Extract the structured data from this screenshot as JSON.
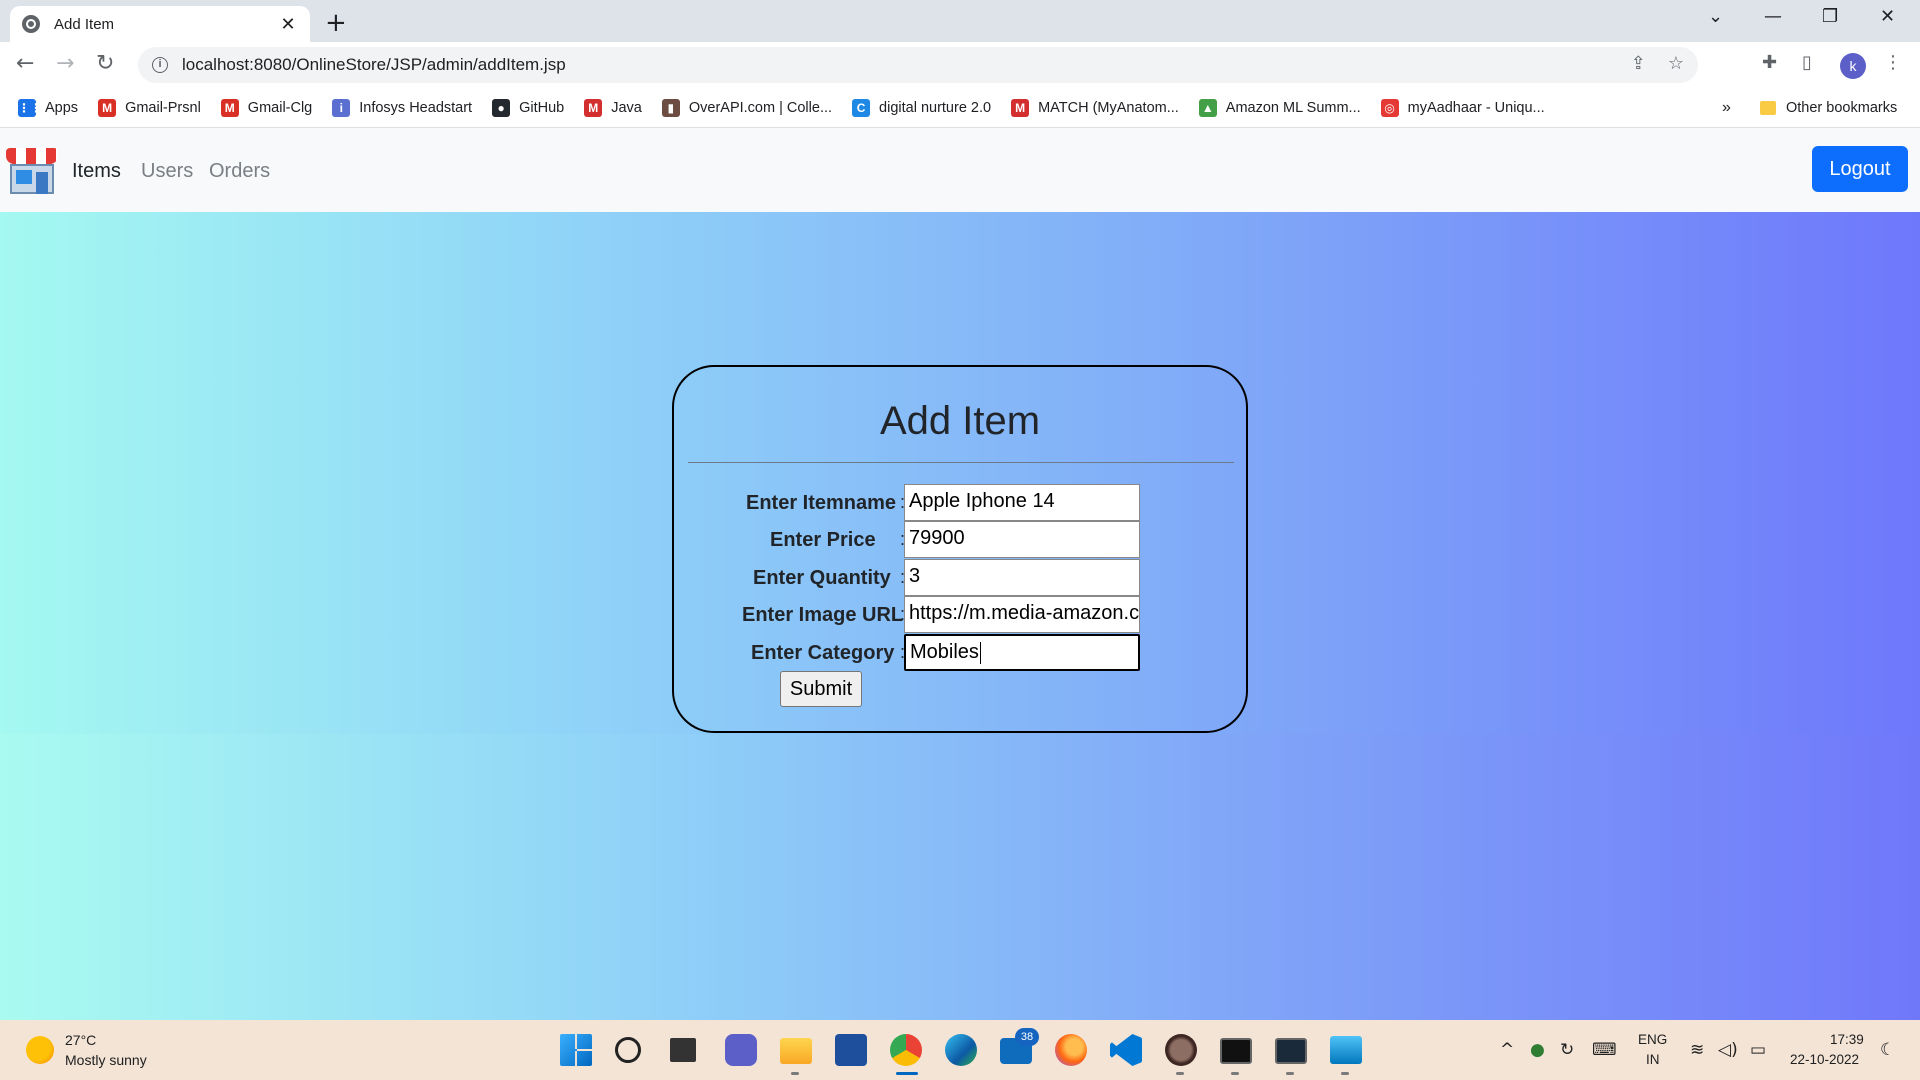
{
  "browser": {
    "tab_title": "Add Item",
    "tab_close": "✕",
    "new_tab": "+",
    "url": "localhost:8080/OnlineStore/JSP/admin/addItem.jsp",
    "profile_initial": "k",
    "window_controls": {
      "chevron": "⌄",
      "minimize": "—",
      "restore": "❐",
      "close": "✕"
    },
    "bookmarks": [
      {
        "label": "Apps",
        "icon": "apps-grid-icon",
        "color": "#1a73e8"
      },
      {
        "label": "Gmail-Prsnl",
        "icon": "gmail-icon",
        "color": "#d93025"
      },
      {
        "label": "Gmail-Clg",
        "icon": "gmail-icon",
        "color": "#d93025"
      },
      {
        "label": "Infosys Headstart",
        "icon": "infosys-icon",
        "color": "#5b6fd1"
      },
      {
        "label": "GitHub",
        "icon": "github-icon",
        "color": "#24292f"
      },
      {
        "label": "Java",
        "icon": "java-icon",
        "color": "#d32f2f"
      },
      {
        "label": "OverAPI.com | Colle...",
        "icon": "overapi-icon",
        "color": "#6d4c41"
      },
      {
        "label": "digital nurture 2.0",
        "icon": "digital-nurture-icon",
        "color": "#1e88e5"
      },
      {
        "label": "MATCH (MyAnatom...",
        "icon": "match-icon",
        "color": "#d32f2f"
      },
      {
        "label": "Amazon ML Summ...",
        "icon": "amazon-ml-icon",
        "color": "#43a047"
      },
      {
        "label": "myAadhaar - Uniqu...",
        "icon": "aadhaar-icon",
        "color": "#e53935"
      }
    ],
    "more_bookmarks": "»",
    "other_bookmarks": "Other bookmarks"
  },
  "site_nav": {
    "links": [
      {
        "label": "Items",
        "active": true
      },
      {
        "label": "Users",
        "active": false
      },
      {
        "label": "Orders",
        "active": false
      }
    ],
    "logout_label": "Logout",
    "accent": "#0d6efd"
  },
  "form": {
    "title": "Add Item",
    "fields": [
      {
        "label": "Enter Itemname",
        "colon": ":",
        "value": "Apple Iphone 14"
      },
      {
        "label": "Enter Price",
        "colon": ":",
        "value": "79900"
      },
      {
        "label": "Enter Quantity",
        "colon": ":",
        "value": "3"
      },
      {
        "label": "Enter Image URL",
        "colon": ":",
        "value": "https://m.media-amazon.com"
      },
      {
        "label": "Enter Category",
        "colon": ":",
        "value": "Mobiles"
      }
    ],
    "submit_label": "Submit"
  },
  "taskbar": {
    "weather_temp": "27°C",
    "weather_desc": "Mostly sunny",
    "mail_badge": "38",
    "lang_top": "ENG",
    "lang_bottom": "IN",
    "time": "17:39",
    "date": "22-10-2022"
  }
}
